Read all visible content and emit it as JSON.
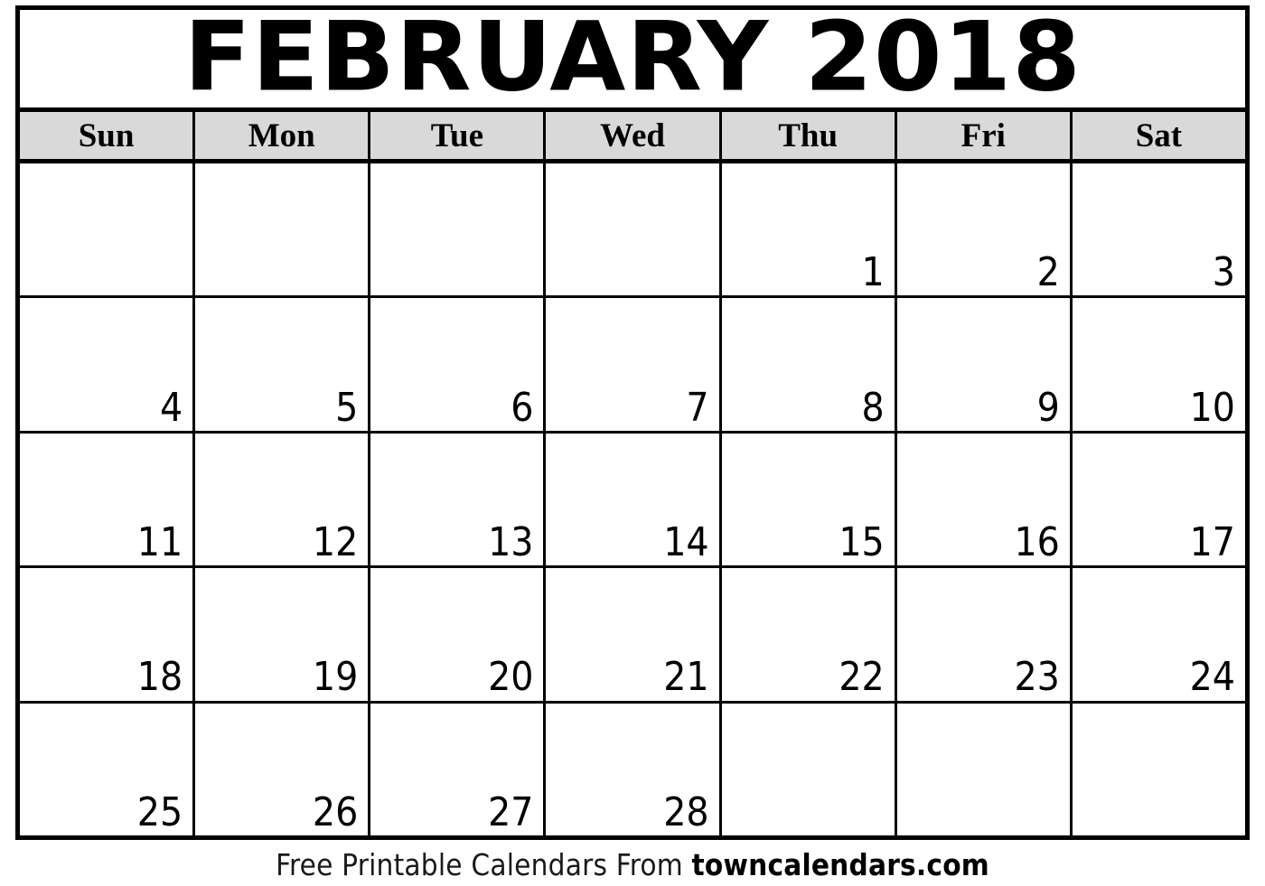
{
  "title": {
    "month_year": "FEBRUARY 2018"
  },
  "weekdays": [
    {
      "label": "Sun"
    },
    {
      "label": "Mon"
    },
    {
      "label": "Tue"
    },
    {
      "label": "Wed"
    },
    {
      "label": "Thu"
    },
    {
      "label": "Fri"
    },
    {
      "label": "Sat"
    }
  ],
  "weeks": [
    {
      "days": [
        {
          "num": ""
        },
        {
          "num": ""
        },
        {
          "num": ""
        },
        {
          "num": ""
        },
        {
          "num": "1"
        },
        {
          "num": "2"
        },
        {
          "num": "3"
        }
      ]
    },
    {
      "days": [
        {
          "num": "4"
        },
        {
          "num": "5"
        },
        {
          "num": "6"
        },
        {
          "num": "7"
        },
        {
          "num": "8"
        },
        {
          "num": "9"
        },
        {
          "num": "10"
        }
      ]
    },
    {
      "days": [
        {
          "num": "11"
        },
        {
          "num": "12"
        },
        {
          "num": "13"
        },
        {
          "num": "14"
        },
        {
          "num": "15"
        },
        {
          "num": "16"
        },
        {
          "num": "17"
        }
      ]
    },
    {
      "days": [
        {
          "num": "18"
        },
        {
          "num": "19"
        },
        {
          "num": "20"
        },
        {
          "num": "21"
        },
        {
          "num": "22"
        },
        {
          "num": "23"
        },
        {
          "num": "24"
        }
      ]
    },
    {
      "days": [
        {
          "num": "25"
        },
        {
          "num": "26"
        },
        {
          "num": "27"
        },
        {
          "num": "28"
        },
        {
          "num": ""
        },
        {
          "num": ""
        },
        {
          "num": ""
        }
      ]
    }
  ],
  "footer": {
    "prefix": "Free Printable Calendars From ",
    "domain": "towncalendars.com"
  },
  "colors": {
    "header_band_background": "#d9d9d9",
    "grid_line": "#000000",
    "page_background": "#ffffff",
    "text": "#000000"
  }
}
